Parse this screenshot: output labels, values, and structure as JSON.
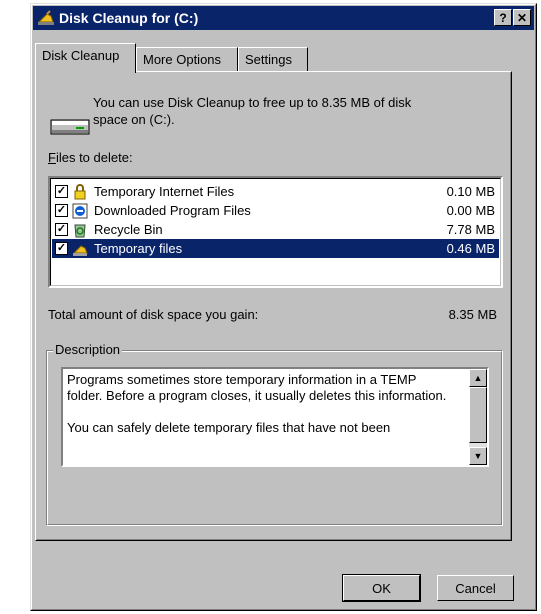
{
  "window": {
    "title": "Disk Cleanup for  (C:)",
    "help_label": "?",
    "close_label": "✕"
  },
  "tabs": [
    {
      "label": "Disk Cleanup",
      "active": true
    },
    {
      "label": "More Options",
      "active": false
    },
    {
      "label": "Settings",
      "active": false
    }
  ],
  "summary": {
    "line1": "You can use Disk Cleanup to free up to 8.35 MB of disk",
    "line2": "space on  (C:)."
  },
  "files_label_prefix": "F",
  "files_label_rest": "iles to delete:",
  "files": [
    {
      "name": "Temporary Internet Files",
      "size": "0.10 MB",
      "checked": true,
      "icon": "lock-icon",
      "selected": false
    },
    {
      "name": "Downloaded Program Files",
      "size": "0.00 MB",
      "checked": true,
      "icon": "ie-icon",
      "selected": false
    },
    {
      "name": "Recycle Bin",
      "size": "7.78 MB",
      "checked": true,
      "icon": "recycle-bin-icon",
      "selected": false
    },
    {
      "name": "Temporary files",
      "size": "0.46 MB",
      "checked": true,
      "icon": "cleanup-icon",
      "selected": true
    }
  ],
  "total": {
    "label": "Total amount of disk space you gain:",
    "value": "8.35 MB"
  },
  "description": {
    "legend": "Description",
    "para1": "Programs sometimes store temporary information in a TEMP folder. Before a program closes, it usually deletes this information.",
    "para2": "You can safely delete temporary files that have not been"
  },
  "buttons": {
    "ok": "OK",
    "cancel": "Cancel"
  },
  "colors": {
    "titlebar": "#0a246a",
    "selection": "#0a246a",
    "face": "#c0c0c0"
  }
}
